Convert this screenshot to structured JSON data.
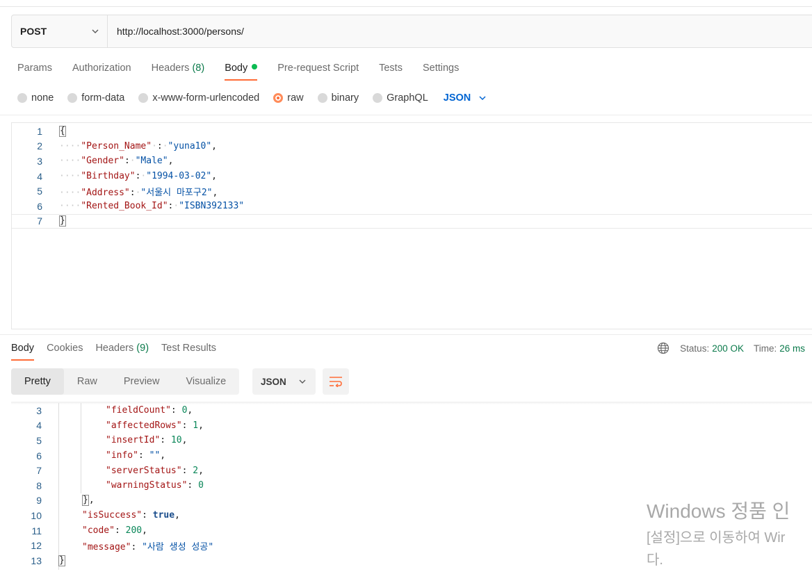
{
  "request": {
    "method": "POST",
    "url": "http://localhost:3000/persons/"
  },
  "request_tabs": [
    {
      "label": "Params"
    },
    {
      "label": "Authorization"
    },
    {
      "label": "Headers",
      "count": "(8)"
    },
    {
      "label": "Body",
      "active": true
    },
    {
      "label": "Pre-request Script"
    },
    {
      "label": "Tests"
    },
    {
      "label": "Settings"
    }
  ],
  "body_types": [
    "none",
    "form-data",
    "x-www-form-urlencoded",
    "raw",
    "binary",
    "GraphQL"
  ],
  "selected_body_type": "raw",
  "body_format": "JSON",
  "request_body_lines": [
    {
      "n": "1"
    },
    {
      "n": "2",
      "key": "\"Person_Name\"",
      "value": "\"yuna10\""
    },
    {
      "n": "3",
      "key": "\"Gender\"",
      "value": "\"Male\""
    },
    {
      "n": "4",
      "key": "\"Birthday\"",
      "value": "\"1994-03-02\""
    },
    {
      "n": "5",
      "key": "\"Address\"",
      "value": "\"서울시 마포구2\""
    },
    {
      "n": "6",
      "key": "\"Rented_Book_Id\"",
      "value": "\"ISBN392133\""
    },
    {
      "n": "7"
    }
  ],
  "response_tabs": [
    {
      "label": "Body",
      "active": true
    },
    {
      "label": "Cookies"
    },
    {
      "label": "Headers",
      "count": "(9)"
    },
    {
      "label": "Test Results"
    }
  ],
  "status": {
    "status_label": "Status:",
    "status_value": "200 OK",
    "time_label": "Time:",
    "time_value": "26 ms"
  },
  "view_modes": [
    "Pretty",
    "Raw",
    "Preview",
    "Visualize"
  ],
  "active_view_mode": "Pretty",
  "response_format": "JSON",
  "response_body_lines": [
    {
      "n": "3",
      "key": "\"fieldCount\"",
      "value": "0"
    },
    {
      "n": "4",
      "key": "\"affectedRows\"",
      "value": "1"
    },
    {
      "n": "5",
      "key": "\"insertId\"",
      "value": "10"
    },
    {
      "n": "6",
      "key": "\"info\"",
      "value": "\"\""
    },
    {
      "n": "7",
      "key": "\"serverStatus\"",
      "value": "2"
    },
    {
      "n": "8",
      "key": "\"warningStatus\"",
      "value": "0"
    },
    {
      "n": "9"
    },
    {
      "n": "10",
      "key": "\"isSuccess\"",
      "value": "true"
    },
    {
      "n": "11",
      "key": "\"code\"",
      "value": "200"
    },
    {
      "n": "12",
      "key": "\"message\"",
      "value": "\"사람 생성 성공\""
    },
    {
      "n": "13"
    }
  ],
  "watermark": {
    "line1": "Windows 정품 인",
    "line2": "[설정]으로 이동하여 Wir",
    "line3": "다."
  },
  "colors": {
    "accent": "#ff6c37",
    "success": "#0cbb52",
    "link_blue": "#0265d2"
  }
}
